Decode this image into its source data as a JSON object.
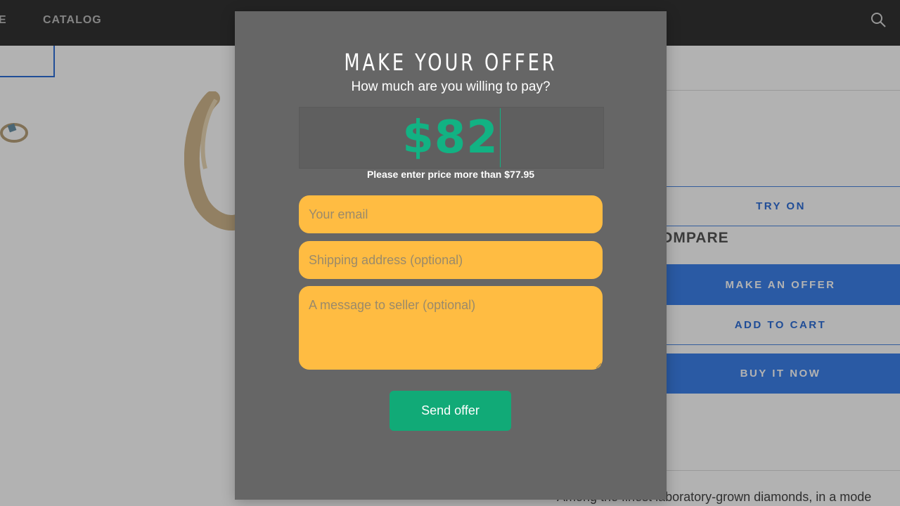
{
  "nav": {
    "partial_item": "E",
    "catalog": "CATALOG",
    "search_icon": "search-icon"
  },
  "product": {
    "try_on": "TRY ON",
    "compare": "OMPARE",
    "make_offer": "MAKE AN OFFER",
    "add_to_cart": "ADD TO CART",
    "buy_now": "BUY IT NOW",
    "description": "Among the finest laboratory-grown diamonds, in a mode"
  },
  "modal": {
    "title": "MAKE YOUR OFFER",
    "subtitle": "How much are you willing to pay?",
    "price": "$82",
    "price_hint": "Please enter price more than $77.95",
    "email_placeholder": "Your email",
    "address_placeholder": "Shipping address (optional)",
    "message_placeholder": "A message to seller (optional)",
    "send_label": "Send offer"
  },
  "colors": {
    "accent_green": "#12b283",
    "field_yellow": "#ffbc42",
    "brand_blue": "#3d82eb",
    "modal_bg": "#666666"
  }
}
